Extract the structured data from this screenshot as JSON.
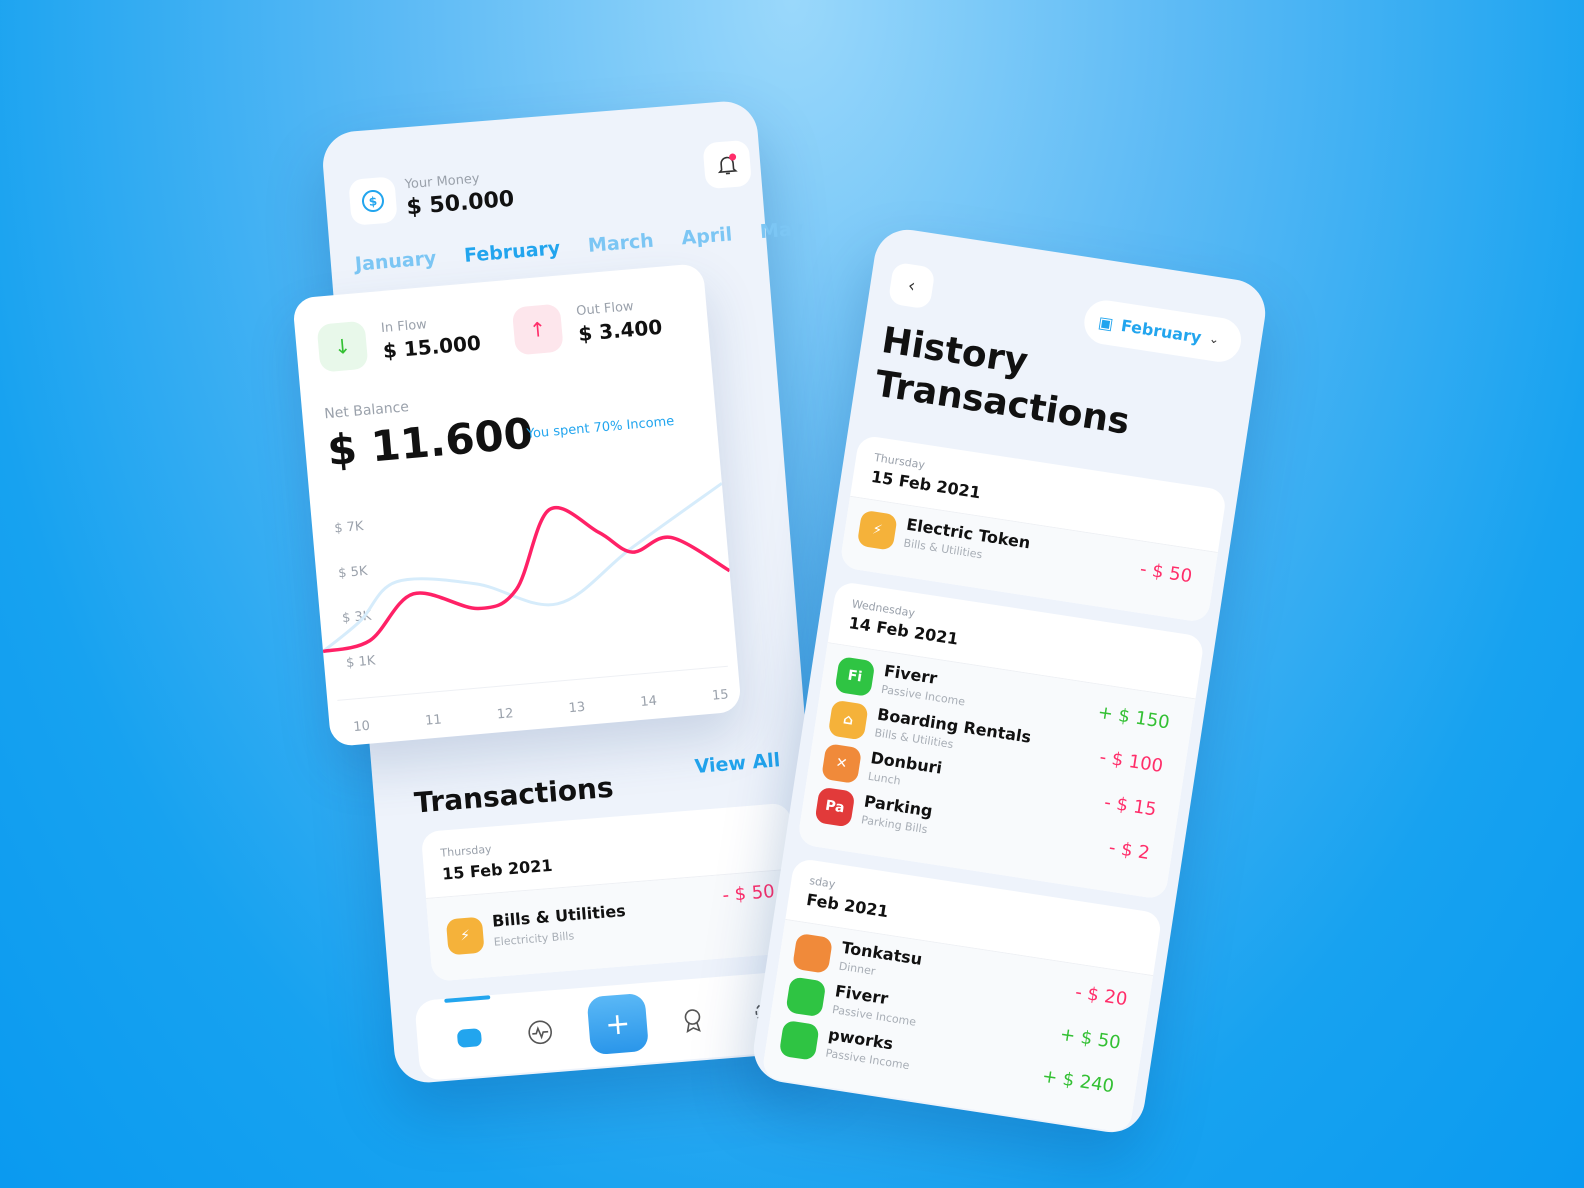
{
  "colors": {
    "accent": "#22a5ee",
    "negative": "#ff2e6a",
    "positive": "#33c033",
    "chart_primary": "#ff2166",
    "chart_secondary": "#d6ecfb"
  },
  "home": {
    "money_label": "Your Money",
    "money_value": "$ 50.000",
    "months": [
      "January",
      "February",
      "March",
      "April",
      "May"
    ],
    "active_month": "February",
    "inflow_label": "In Flow",
    "inflow_value": "$ 15.000",
    "outflow_label": "Out Flow",
    "outflow_value": "$ 3.400",
    "net_label": "Net Balance",
    "net_value": "$ 11.600",
    "spent_note": "You spent 70% Income",
    "transactions_title": "Transactions",
    "view_all": "View All",
    "tx_day": "Thursday",
    "tx_date": "15 Feb 2021",
    "tx": {
      "name": "Bills &  Utilities",
      "sub": "Electricity Bills",
      "amount": "- $ 50",
      "icon": "lightning-icon"
    },
    "nav": [
      "wallet-icon",
      "activity-icon",
      "plus-icon",
      "award-icon",
      "gear-icon"
    ],
    "nav_active": 0
  },
  "chart_data": {
    "type": "line",
    "x_ticks": [
      "10",
      "11",
      "12",
      "13",
      "14",
      "15"
    ],
    "y_ticks": [
      "$ 7K",
      "$ 5K",
      "$ 3K",
      "$ 1K"
    ],
    "ylim": [
      0,
      8
    ],
    "xlim": [
      10,
      15.2
    ],
    "series": [
      {
        "x": [
          10,
          10.6,
          11.2,
          12,
          12.5,
          13,
          13.6,
          14,
          14.5,
          15.2
        ],
        "y": [
          1.6,
          1.9,
          3.8,
          2.9,
          3.6,
          7.0,
          5.8,
          4.8,
          5.3,
          3.6
        ]
      },
      {
        "x": [
          10,
          10.5,
          11,
          12,
          13,
          14,
          15.2
        ],
        "y": [
          1.6,
          2.8,
          4.4,
          4.0,
          2.8,
          5.0,
          7.5
        ]
      }
    ]
  },
  "history": {
    "title_line1": "History",
    "title_line2": "Transactions",
    "month": "February",
    "groups": [
      {
        "day": "Thursday",
        "date": "15 Feb 2021",
        "items": [
          {
            "name": "Electric Token",
            "sub": "Bills &  Utilities",
            "amount": "- $ 50",
            "sign": "neg",
            "icon": "lightning-icon",
            "badge": "",
            "color": "#f5b23a"
          }
        ]
      },
      {
        "day": "Wednesday",
        "date": "14 Feb 2021",
        "items": [
          {
            "name": "Fiverr",
            "sub": "Passive Income",
            "amount": "+ $ 150",
            "sign": "pos",
            "icon": "",
            "badge": "Fi",
            "color": "#2fc443"
          },
          {
            "name": "Boarding Rentals",
            "sub": "Bills &  Utilities",
            "amount": "- $ 100",
            "sign": "neg",
            "icon": "house-icon",
            "badge": "",
            "color": "#f5b23a"
          },
          {
            "name": "Donburi",
            "sub": "Lunch",
            "amount": "- $ 15",
            "sign": "neg",
            "icon": "fork-knife-icon",
            "badge": "",
            "color": "#f08a3a"
          },
          {
            "name": "Parking",
            "sub": "Parking Bills",
            "amount": "- $ 2",
            "sign": "neg",
            "icon": "",
            "badge": "Pa",
            "color": "#e23a3a"
          }
        ]
      },
      {
        "day": "sday",
        "date": "Feb 2021",
        "items": [
          {
            "name": "Tonkatsu",
            "sub": "Dinner",
            "amount": "- $ 20",
            "sign": "neg",
            "icon": "",
            "badge": "",
            "color": "#f08a3a"
          },
          {
            "name": "Fiverr",
            "sub": "Passive Income",
            "amount": "+ $ 50",
            "sign": "pos",
            "icon": "",
            "badge": "",
            "color": "#2fc443"
          },
          {
            "name": "pworks",
            "sub": "Passive Income",
            "amount": "+ $ 240",
            "sign": "pos",
            "icon": "",
            "badge": "",
            "color": "#2fc443"
          }
        ]
      }
    ]
  }
}
